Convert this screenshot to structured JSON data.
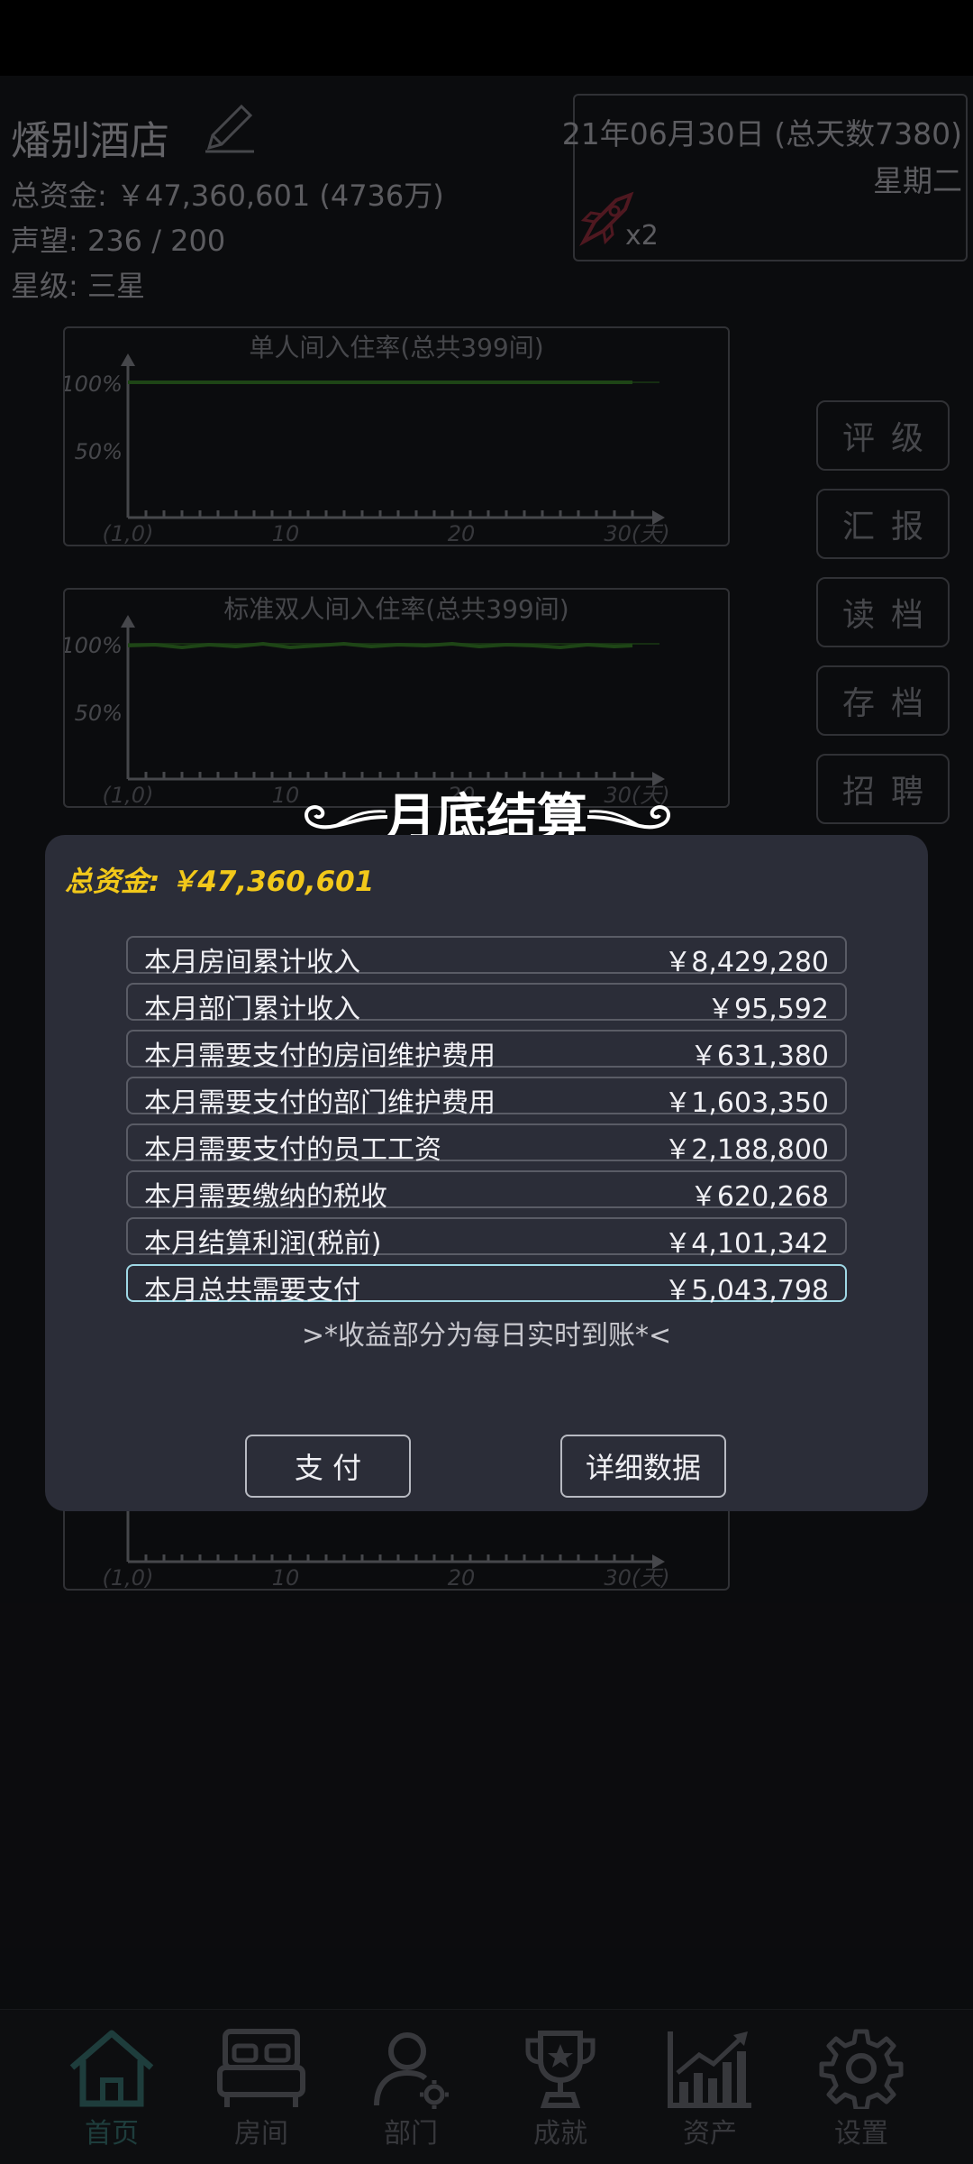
{
  "header": {
    "hotel_name": "燔别酒店",
    "total_funds": "总资金: ￥47,360,601  (4736万)",
    "reputation": "声望: 236 / 200",
    "star_level": "星级: 三星"
  },
  "date_panel": {
    "date": "21年06月30日 (总天数7380)",
    "weekday": "星期二",
    "speed": "x2"
  },
  "charts": [
    {
      "title": "单人间入住率(总共399间)",
      "y_ticks": [
        "100%",
        "50%"
      ],
      "x_ticks": [
        "(1,0)",
        "10",
        "20",
        "30(天)"
      ]
    },
    {
      "title": "标准双人间入住率(总共399间)",
      "y_ticks": [
        "100%",
        "50%"
      ],
      "x_ticks": [
        "(1,0)",
        "10",
        "20",
        "30(天)"
      ]
    },
    {
      "title": "",
      "y_ticks": [],
      "x_ticks": [
        "(1,0)",
        "10",
        "20",
        "30(天)"
      ]
    }
  ],
  "side_buttons": [
    "评级",
    "汇报",
    "读档",
    "存档",
    "招聘"
  ],
  "bottom_nav": [
    {
      "label": "首页",
      "icon": "home-icon"
    },
    {
      "label": "房间",
      "icon": "bed-icon"
    },
    {
      "label": "部门",
      "icon": "staff-icon"
    },
    {
      "label": "成就",
      "icon": "trophy-icon"
    },
    {
      "label": "资产",
      "icon": "chart-icon"
    },
    {
      "label": "设置",
      "icon": "gear-icon"
    }
  ],
  "modal": {
    "title": "月底结算",
    "total_funds": "总资金: ￥47,360,601",
    "rows": [
      {
        "label": "本月房间累计收入",
        "value": "￥8,429,280"
      },
      {
        "label": "本月部门累计收入",
        "value": "￥95,592"
      },
      {
        "label": "本月需要支付的房间维护费用",
        "value": "￥631,380"
      },
      {
        "label": "本月需要支付的部门维护费用",
        "value": "￥1,603,350"
      },
      {
        "label": "本月需要支付的员工工资",
        "value": "￥2,188,800"
      },
      {
        "label": "本月需要缴纳的税收",
        "value": "￥620,268"
      },
      {
        "label": "本月结算利润(税前)",
        "value": "￥4,101,342"
      },
      {
        "label": "本月总共需要支付",
        "value": "￥5,043,798"
      }
    ],
    "note": ">*收益部分为每日实时到账*<",
    "pay_button": "支 付",
    "details_button": "详细数据"
  },
  "colors": {
    "accent_gold": "#f2c81a",
    "highlight_border": "#9fd8e6",
    "nav_active": "#2f5f5d",
    "chart_line": "#2e6b22"
  }
}
